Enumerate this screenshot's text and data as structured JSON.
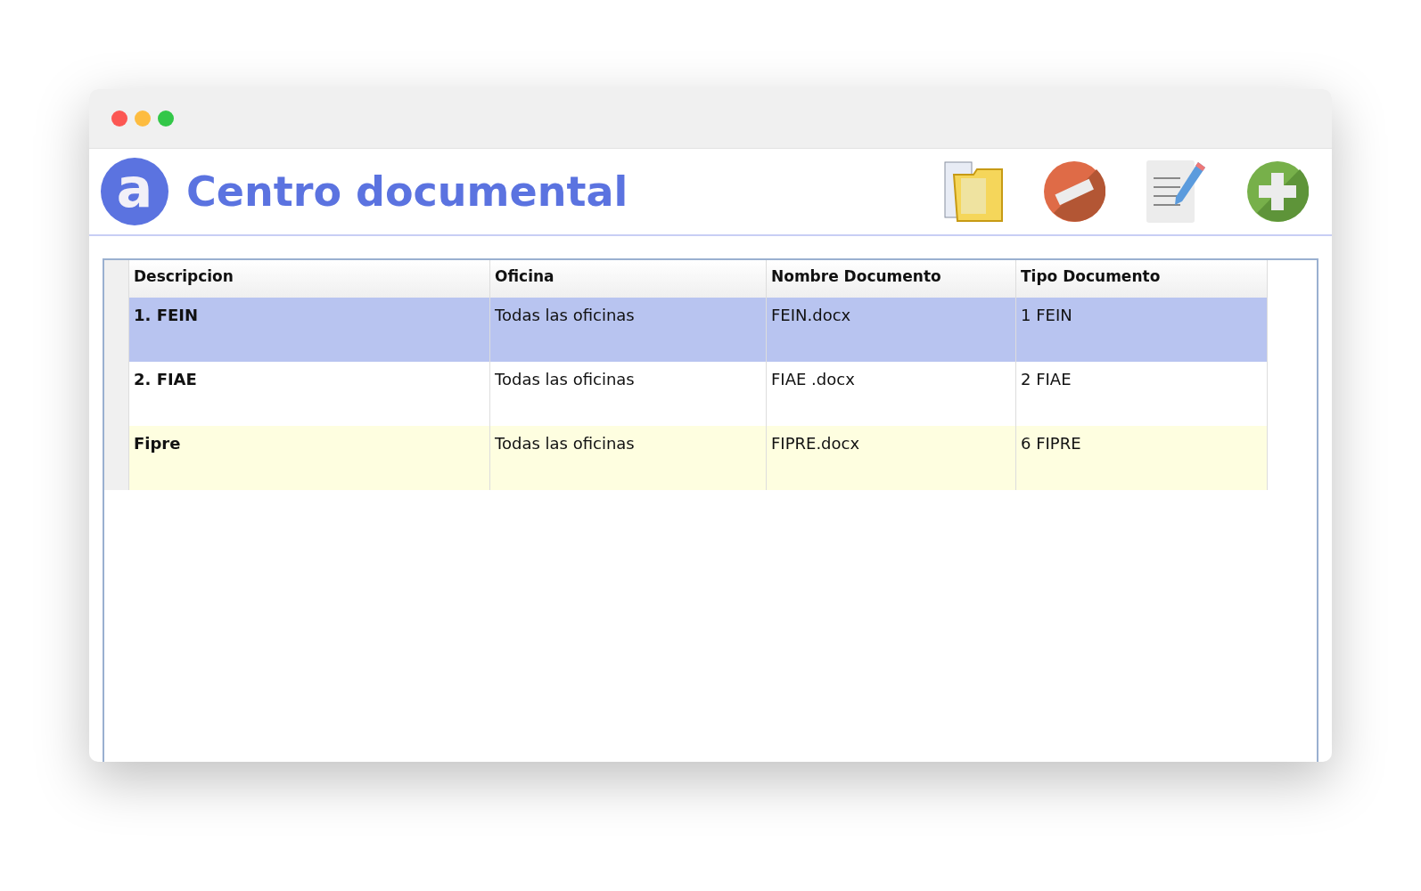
{
  "header": {
    "logo_letter": "a",
    "title": "Centro documental"
  },
  "toolbar": [
    {
      "kind": "folder"
    },
    {
      "kind": "remove"
    },
    {
      "kind": "edit"
    },
    {
      "kind": "add"
    }
  ],
  "table": {
    "columns": [
      "Descripcion",
      "Oficina",
      "Nombre Documento",
      "Tipo Documento"
    ],
    "rows": [
      {
        "selected": true,
        "cells": [
          "1. FEIN",
          "Todas las oficinas",
          "FEIN.docx",
          "1 FEIN"
        ]
      },
      {
        "selected": false,
        "cells": [
          "2. FIAE",
          "Todas las oficinas",
          "FIAE .docx",
          "2 FIAE"
        ]
      },
      {
        "selected": false,
        "cells": [
          "Fipre",
          "Todas las oficinas",
          "FIPRE.docx",
          "6 FIPRE"
        ]
      }
    ]
  }
}
